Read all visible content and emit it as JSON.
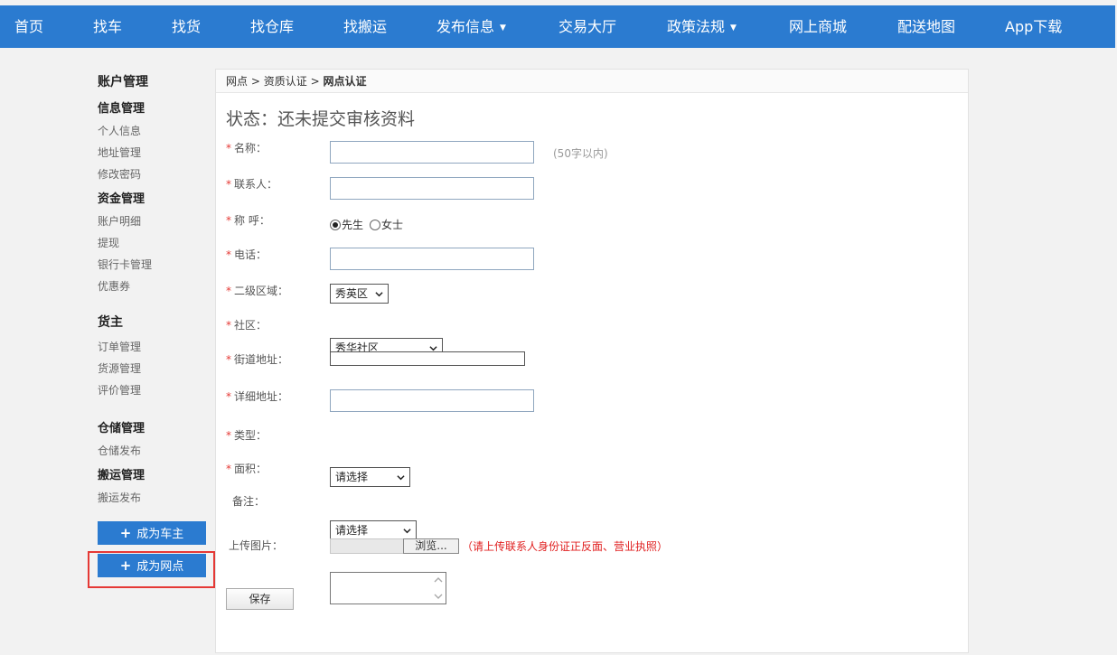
{
  "nav": {
    "items": [
      {
        "label": "首页"
      },
      {
        "label": "找车"
      },
      {
        "label": "找货"
      },
      {
        "label": "找仓库"
      },
      {
        "label": "找搬运"
      },
      {
        "label": "发布信息",
        "caret": "▼"
      },
      {
        "label": "交易大厅"
      },
      {
        "label": "政策法规",
        "caret": "▼"
      },
      {
        "label": "网上商城"
      },
      {
        "label": "配送地图"
      },
      {
        "label": "App下载"
      }
    ]
  },
  "sidebar": {
    "account_title": "账户管理",
    "info_title": "信息管理",
    "info_items": [
      "个人信息",
      "地址管理",
      "修改密码"
    ],
    "fund_title": "资金管理",
    "fund_items": [
      "账户明细",
      "提现",
      "银行卡管理",
      "优惠券"
    ],
    "shipper_title": "货主",
    "shipper_items": [
      "订单管理",
      "货源管理",
      "评价管理"
    ],
    "storage_title": "仓储管理",
    "storage_items": [
      "仓储发布"
    ],
    "moving_title": "搬运管理",
    "moving_items": [
      "搬运发布"
    ],
    "btn_car_owner": "成为车主",
    "btn_outlet": "成为网点",
    "plus": "+"
  },
  "breadcrumb": {
    "part1": "网点",
    "sep": ">",
    "part2": "资质认证",
    "current": "网点认证"
  },
  "status": "状态：还未提交审核资料",
  "form": {
    "required_mark": "*",
    "name_label": "名称：",
    "name_value": "",
    "name_hint": "(50字以内)",
    "contact_label": "联系人：",
    "contact_value": "",
    "title_label": "称 呼：",
    "title_opt_mr": "先生",
    "title_opt_ms": "女士",
    "title_selected": "先生",
    "phone_label": "电话：",
    "phone_value": "",
    "region_label": "二级区域：",
    "region_value": "秀英区",
    "community_label": "社区：",
    "community_value": "秀华社区",
    "street_label": "街道地址：",
    "street_value": "",
    "detail_label": "详细地址：",
    "detail_value": "",
    "type_label": "类型：",
    "type_value": "请选择",
    "area_label": "面积：",
    "area_value": "请选择",
    "remark_label": "备注：",
    "remark_value": "",
    "upload_label": "上传图片：",
    "upload_button": "浏览...",
    "upload_note": "（请上传联系人身份证正反面、营业执照）",
    "save_button": "保存"
  },
  "colors": {
    "nav_bg": "#2b7bd0",
    "required": "#e53935",
    "highlight_border": "#e53935"
  }
}
